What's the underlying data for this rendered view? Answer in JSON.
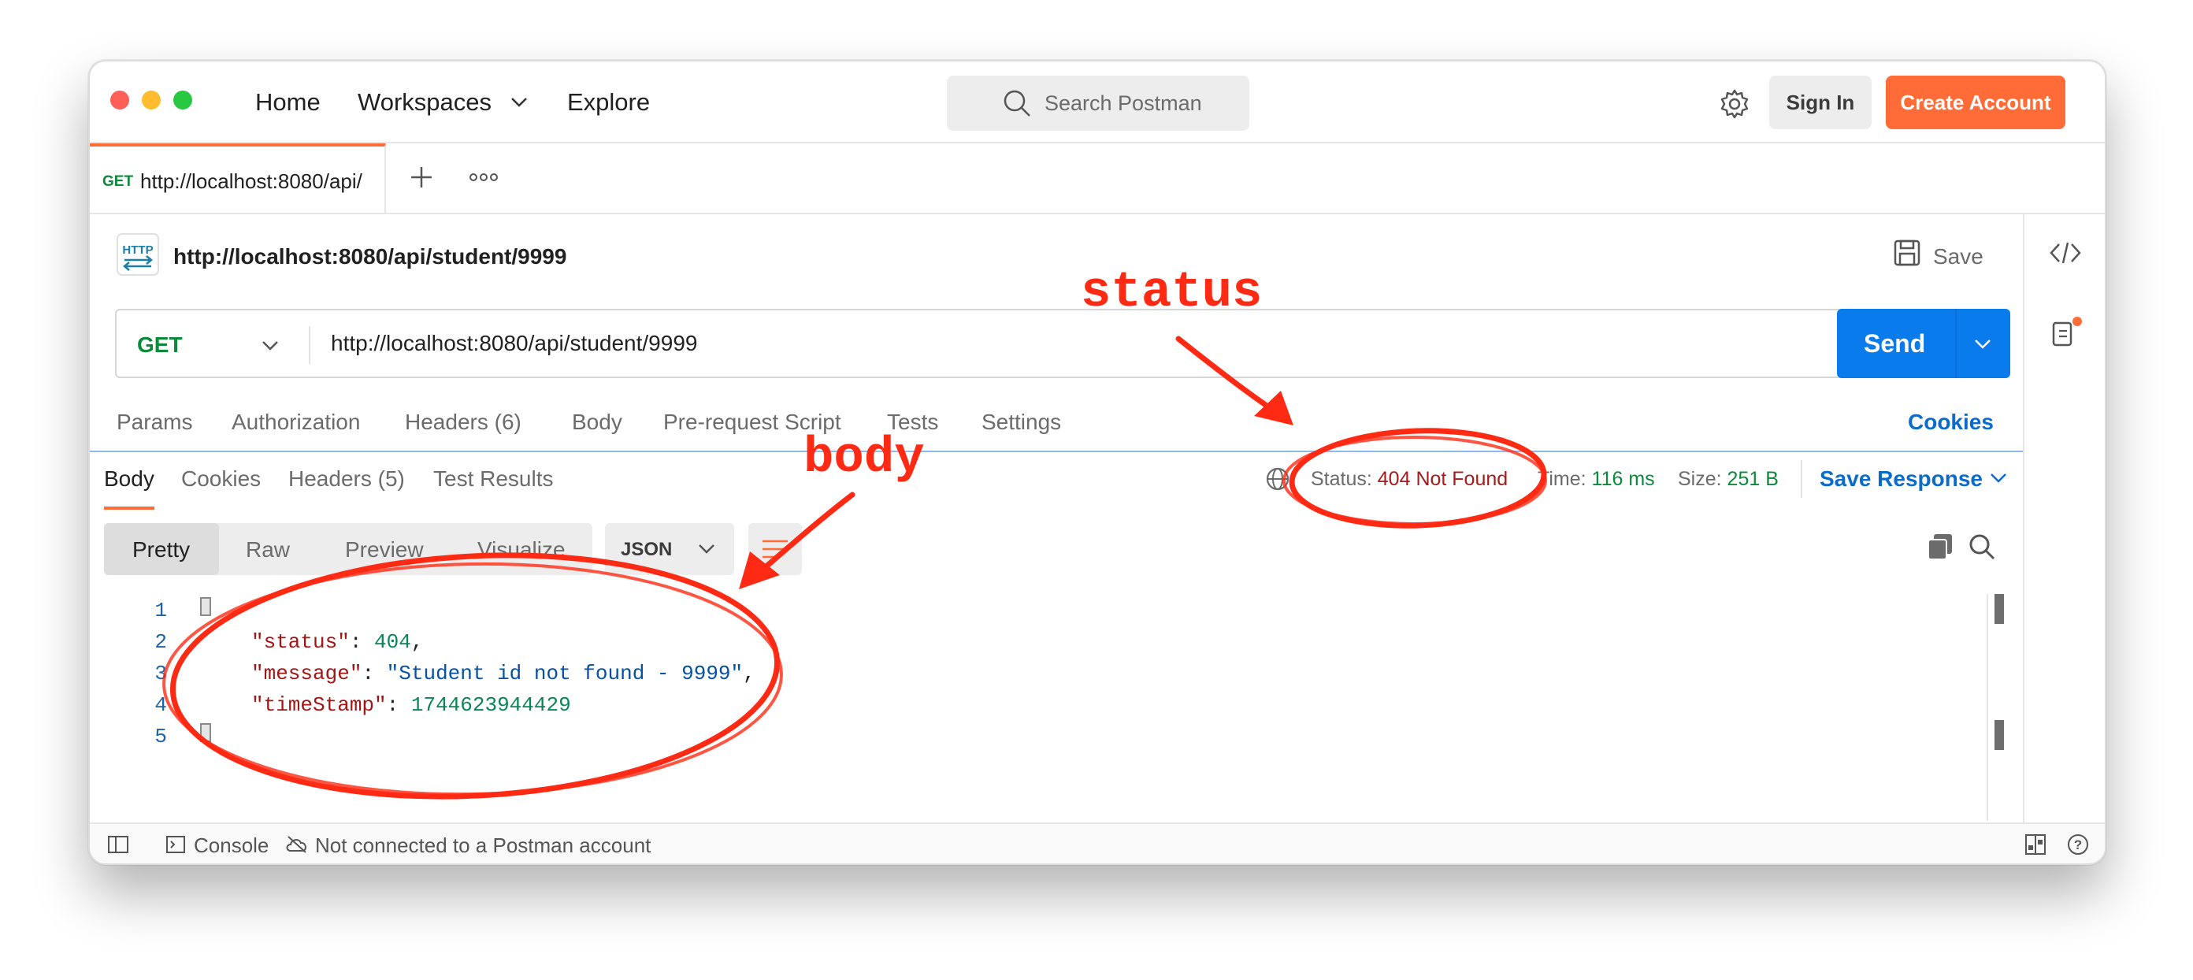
{
  "nav": {
    "home": "Home",
    "workspaces": "Workspaces",
    "explore": "Explore",
    "search_placeholder": "Search Postman",
    "sign_in": "Sign In",
    "create_account": "Create Account"
  },
  "tab": {
    "method": "GET",
    "url": "http://localhost:8080/api/"
  },
  "request": {
    "title": "http://localhost:8080/api/student/9999",
    "save_label": "Save",
    "method": "GET",
    "url": "http://localhost:8080/api/student/9999",
    "send_label": "Send",
    "tabs": [
      "Params",
      "Authorization",
      "Headers",
      "Body",
      "Pre-request Script",
      "Tests",
      "Settings"
    ],
    "headers_count": "(6)",
    "cookies_link": "Cookies"
  },
  "response": {
    "tabs": [
      "Body",
      "Cookies",
      "Headers",
      "Test Results"
    ],
    "headers_count": "(5)",
    "status_label": "Status:",
    "status_value": "404 Not Found",
    "time_label": "Time:",
    "time_value": "116 ms",
    "size_label": "Size:",
    "size_value": "251 B",
    "save_response": "Save Response",
    "views": [
      "Pretty",
      "Raw",
      "Preview",
      "Visualize"
    ],
    "format": "JSON",
    "lines": [
      "1",
      "2",
      "3",
      "4",
      "5"
    ],
    "body": {
      "k_status": "\"status\"",
      "v_status": "404",
      "k_message": "\"message\"",
      "v_message": "\"Student id not found - 9999\"",
      "k_timestamp": "\"timeStamp\"",
      "v_timestamp": "1744623944429"
    }
  },
  "footer": {
    "console": "Console",
    "connection": "Not connected to a Postman account"
  },
  "annotations": {
    "status": "status",
    "body": "body"
  },
  "colors": {
    "accent": "#ff6c37",
    "send": "#097bed",
    "annotation": "#ff2a14",
    "get": "#0a8a3a",
    "error": "#a61b1b"
  },
  "icons": [
    "search-icon",
    "gear-icon",
    "chevron-down-icon",
    "plus-icon",
    "more-icon",
    "http-icon",
    "save-icon",
    "code-icon",
    "info-icon",
    "globe-icon",
    "copy-icon",
    "wrap-icon",
    "sidebar-icon",
    "console-icon",
    "cloud-off-icon",
    "layout-icon",
    "help-icon"
  ]
}
